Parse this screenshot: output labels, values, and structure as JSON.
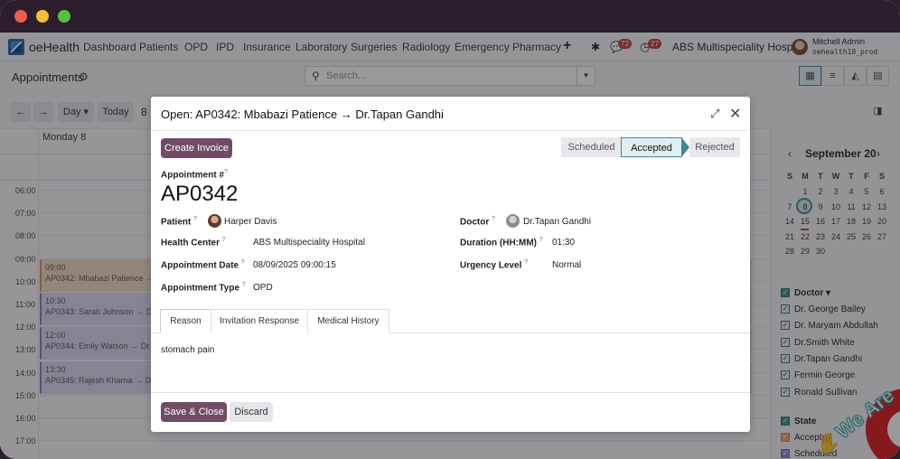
{
  "app": {
    "name": "oeHealth"
  },
  "nav": {
    "items": [
      "Dashboard",
      "Patients",
      "OPD",
      "IPD",
      "Insurance",
      "Laboratory",
      "Surgeries",
      "Radiology",
      "Emergency",
      "Pharmacy"
    ],
    "chat_count": "72",
    "activity_count": "27",
    "company": "ABS Multispeciality Hospital",
    "user_name": "Mitchell Admin",
    "db_name": "oehealth18_prod"
  },
  "control": {
    "breadcrumb": "Appointments",
    "search_placeholder": "Search...",
    "scale": "Day",
    "today": "Today",
    "day_num": "8"
  },
  "calendar": {
    "day_header": "Monday  8",
    "times": [
      "06:00",
      "07:00",
      "08:00",
      "09:00",
      "10:00",
      "11:00",
      "12:00",
      "13:00",
      "14:00",
      "15:00",
      "16:00",
      "17:00"
    ],
    "events": [
      {
        "time": "09:00",
        "title": "AP0342: Mbabazi Patience → D",
        "color": "orange"
      },
      {
        "time": "10:30",
        "title": "AP0343: Sarah Johnson → Dr.",
        "color": "purple"
      },
      {
        "time": "12:00",
        "title": "AP0344: Emily Watson → Dr.Ta",
        "color": "purple"
      },
      {
        "time": "13:30",
        "title": "AP0345: Rajesh Kharna → Dr.Ta",
        "color": "purple"
      }
    ]
  },
  "sidebar": {
    "month_title": "September 20",
    "dow": [
      "S",
      "M",
      "T",
      "W",
      "T",
      "F",
      "S"
    ],
    "weeks": [
      [
        "",
        "1",
        "2",
        "3",
        "4",
        "5",
        "6"
      ],
      [
        "7",
        "8",
        "9",
        "10",
        "11",
        "12",
        "13"
      ],
      [
        "14",
        "15",
        "16",
        "17",
        "18",
        "19",
        "20"
      ],
      [
        "21",
        "22",
        "23",
        "24",
        "25",
        "26",
        "27"
      ],
      [
        "28",
        "29",
        "30",
        "",
        "",
        "",
        ""
      ]
    ],
    "doctor_filter_title": "Doctor",
    "doctors": [
      "Dr. George Bailey",
      "Dr. Maryam Abdullah",
      "Dr.Smith White",
      "Dr.Tapan Gandhi",
      "Fermin George",
      "Ronald Sullivan"
    ],
    "state_filter_title": "State",
    "states": [
      "Accepted",
      "Scheduled"
    ],
    "promo_text": "We Are"
  },
  "modal": {
    "title": "Open: AP0342: Mbabazi Patience → Dr.Tapan Gandhi",
    "create_invoice": "Create Invoice",
    "stages": [
      "Scheduled",
      "Accepted",
      "Rejected"
    ],
    "ref_label": "Appointment #",
    "ref": "AP0342",
    "fields_left": [
      {
        "label": "Patient",
        "value": "Harper Davis"
      },
      {
        "label": "Health Center",
        "value": "ABS Multispeciality Hospital"
      },
      {
        "label": "Appointment Date",
        "value": "08/09/2025 09:00:15"
      },
      {
        "label": "Appointment Type",
        "value": "OPD"
      }
    ],
    "fields_right": [
      {
        "label": "Doctor",
        "value": "Dr.Tapan Gandhi"
      },
      {
        "label": "Duration (HH:MM)",
        "value": "01:30"
      },
      {
        "label": "Urgency Level",
        "value": "Normal"
      }
    ],
    "tabs": [
      "Reason",
      "Invitation Response",
      "Medical History"
    ],
    "reason": "stomach pain",
    "save_close": "Save & Close",
    "discard": "Discard"
  }
}
